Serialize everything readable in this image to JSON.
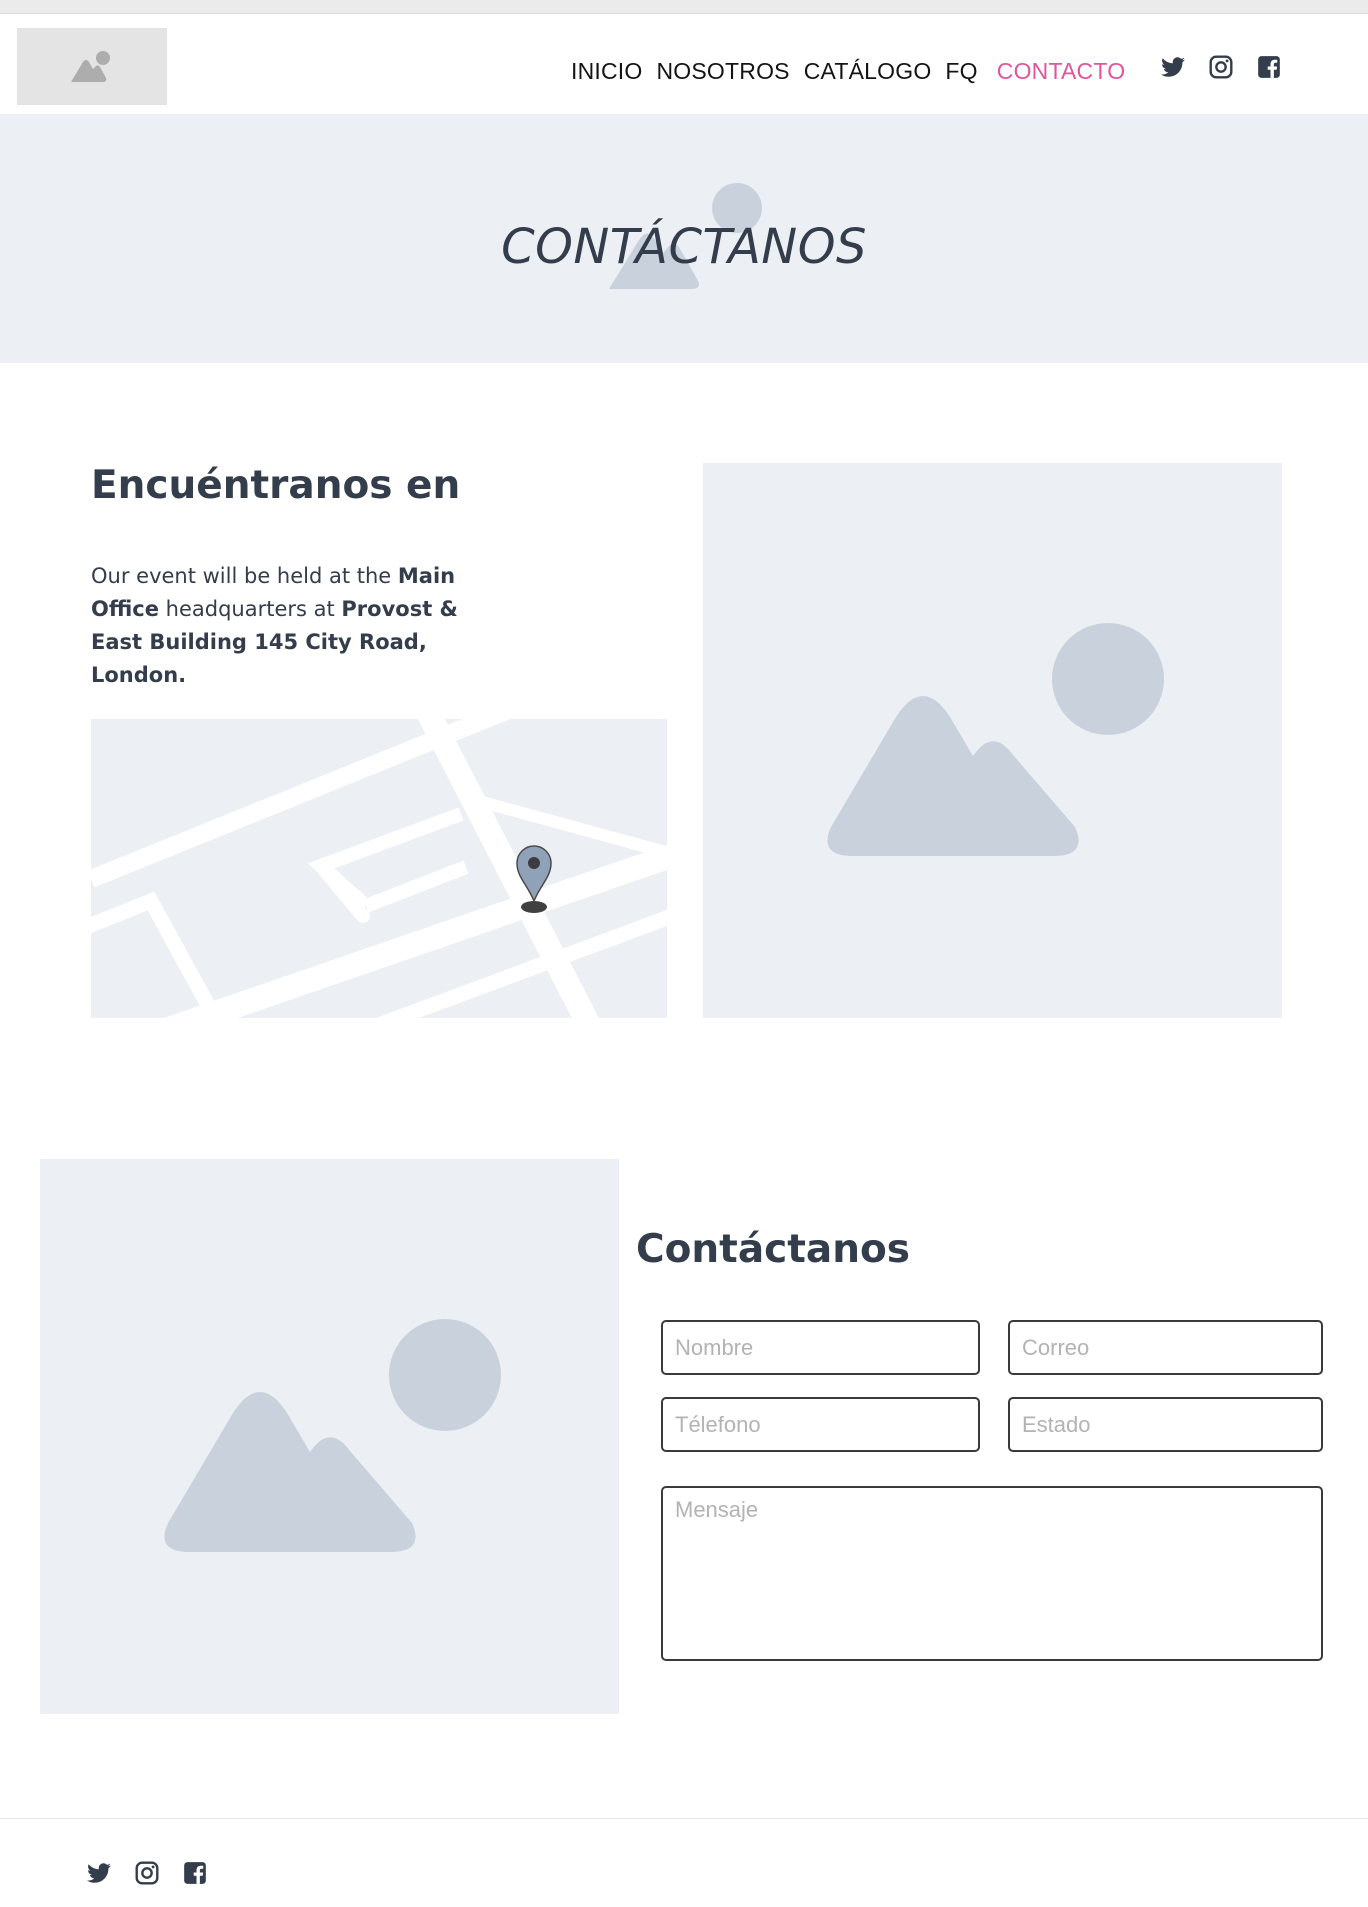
{
  "nav": {
    "items": [
      {
        "label": "INICIO"
      },
      {
        "label": "NOSOTROS"
      },
      {
        "label": "CATÁLOGO"
      },
      {
        "label": "FQ"
      },
      {
        "label": "CONTACTO",
        "active": true
      }
    ],
    "active_color": "#e0559b"
  },
  "social": [
    "twitter-icon",
    "instagram-icon",
    "facebook-icon"
  ],
  "hero": {
    "title": "CONTÁCTANOS"
  },
  "location": {
    "title": "Encuéntranos en",
    "text_1": "Our event will be held at the ",
    "bold_1": "Main Office",
    "text_2": " headquarters at ",
    "bold_2": "Provost & East Building 145 City Road, London."
  },
  "contact": {
    "title": "Contáctanos",
    "fields": {
      "name": "Nombre",
      "email": "Correo",
      "phone": "Télefono",
      "state": "Estado",
      "message": "Mensaje"
    }
  },
  "colors": {
    "text": "#333d4b",
    "placeholder_bg": "#eceff3",
    "placeholder_shape": "#c9d2dc"
  }
}
